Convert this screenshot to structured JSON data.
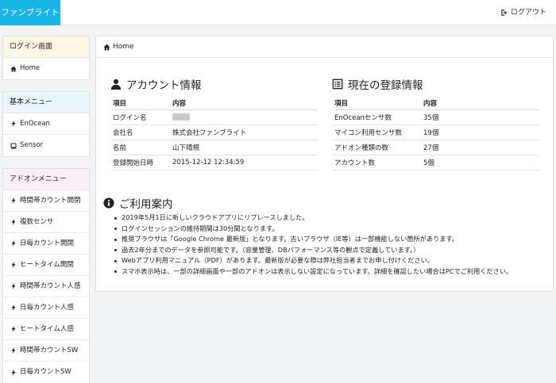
{
  "header": {
    "brand": "ファンブライト",
    "logout_label": "ログアウト"
  },
  "sidebar": {
    "groups": [
      {
        "title": "ログイン画面",
        "items": [
          {
            "label": "Home",
            "icon": "home-icon"
          }
        ]
      },
      {
        "title": "基本メニュー",
        "items": [
          {
            "label": "EnOcean",
            "icon": "bolt-icon"
          },
          {
            "label": "Sensor",
            "icon": "sensor-icon"
          }
        ]
      },
      {
        "title": "アドオンメニュー",
        "items": [
          {
            "label": "時間帯カウント開閉",
            "icon": "bolt-icon"
          },
          {
            "label": "複数センサ",
            "icon": "bolt-icon"
          },
          {
            "label": "日毎カウント開閉",
            "icon": "bolt-icon"
          },
          {
            "label": "ヒートタイム開閉",
            "icon": "bolt-icon"
          },
          {
            "label": "時間帯カウント人感",
            "icon": "bolt-icon"
          },
          {
            "label": "日毎カウント人感",
            "icon": "bolt-icon"
          },
          {
            "label": "ヒートタイム人感",
            "icon": "bolt-icon"
          },
          {
            "label": "時間帯カウントSW",
            "icon": "bolt-icon"
          },
          {
            "label": "日毎カウントSW",
            "icon": "bolt-icon"
          }
        ]
      }
    ]
  },
  "breadcrumb": {
    "label": "Home"
  },
  "account": {
    "title": "アカウント情報",
    "headers": [
      "項目",
      "内容"
    ],
    "rows": [
      {
        "key": "ログイン名",
        "value": ""
      },
      {
        "key": "会社名",
        "value": "株式会社ファンブライト"
      },
      {
        "key": "名前",
        "value": "山下晴規"
      },
      {
        "key": "登録開始日時",
        "value": "2015-12-12 12:34:59"
      }
    ]
  },
  "registration": {
    "title": "現在の登録情報",
    "headers": [
      "項目",
      "内容"
    ],
    "rows": [
      {
        "key": "EnOceanセンサ数",
        "value": "35個"
      },
      {
        "key": "マイコン利用センサ数",
        "value": "19個"
      },
      {
        "key": "アドオン種類の数",
        "value": "27個"
      },
      {
        "key": "アカウント数",
        "value": "5個"
      }
    ]
  },
  "guide": {
    "title": "ご利用案内",
    "items": [
      "2019年5月1日に新しいクラウドアプリにリプレースしました。",
      "ログインセッションの維持期間は30分間となります。",
      "推奨ブラウザは「Google Chrome 最新版」となります。古いブラウザ（IE等）は一部機能しない箇所があります。",
      "過去2年分までのデータを参照可能です。（容量管理、DBパフォーマンス等の観点で定義しています。）",
      "Webアプリ利用マニュアル（PDF）があります。最新版が必要な際は弊社担当者までお申し付けください。",
      "スマホ表示時は、一部の詳細画面や一部のアドオンは表示しない設定になっています。詳細を確認したい場合はPCでご利用ください。"
    ]
  }
}
